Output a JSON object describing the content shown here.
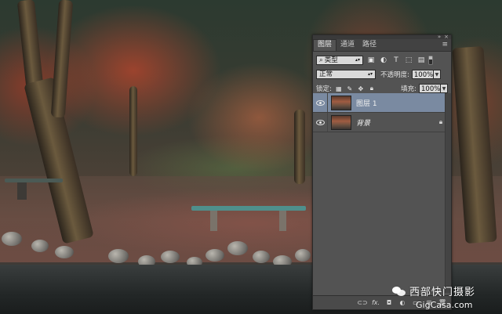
{
  "panel": {
    "tabs": [
      "图层",
      "通道",
      "路径"
    ],
    "active_tab": "图层",
    "filter_kind": "类型",
    "blend_mode": "正常",
    "opacity_label": "不透明度:",
    "opacity_value": "100%",
    "lock_label": "锁定:",
    "fill_label": "填充:",
    "fill_value": "100%",
    "layers": [
      {
        "name": "图层 1",
        "selected": true,
        "visible": true,
        "locked": false
      },
      {
        "name": "背景",
        "selected": false,
        "visible": true,
        "locked": true
      }
    ],
    "footer_icons": [
      "link-icon",
      "fx-icon",
      "mask-icon",
      "adjustment-icon",
      "group-icon",
      "new-layer-icon",
      "trash-icon"
    ],
    "footer_fx_label": "fx."
  },
  "watermark": {
    "brand": "西部快门摄影",
    "url": "GigCasa.com"
  },
  "colors": {
    "panel_bg": "#535353",
    "selected_layer": "#7a8aa1"
  }
}
